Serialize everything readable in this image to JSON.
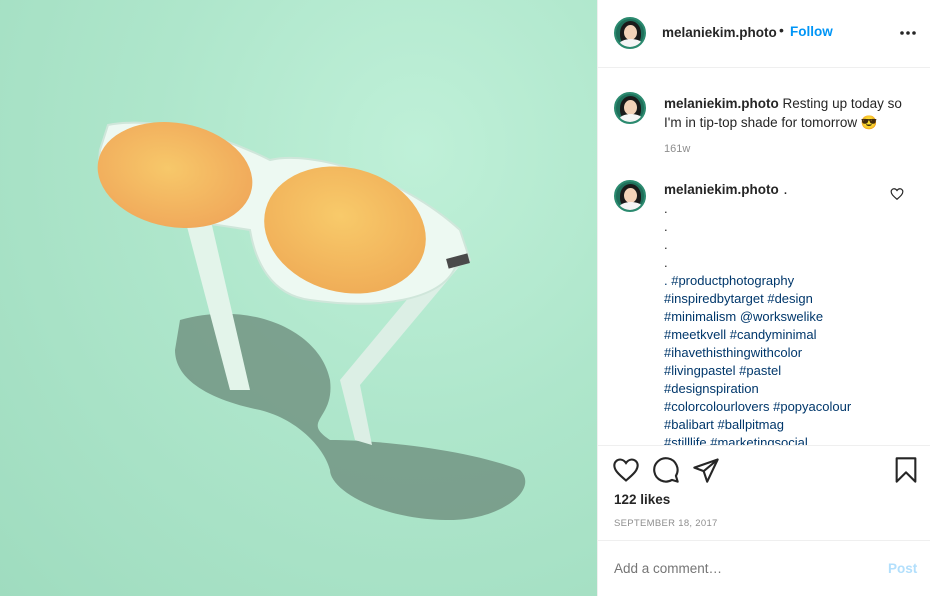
{
  "photo": {
    "alt_subject": "sunglasses-photo"
  },
  "header": {
    "username": "melaniekim.photo",
    "separator": "•",
    "follow_label": "Follow"
  },
  "caption": {
    "username": "melaniekim.photo",
    "text": "Resting up today so I'm in tip-top shade for tomorrow",
    "emoji": "😎",
    "time": "161w"
  },
  "comment": {
    "username": "melaniekim.photo",
    "first_line": ".",
    "dot_lines": [
      ".",
      ".",
      ".",
      "."
    ],
    "tag_lines": [
      ". #productphotography",
      "#inspiredbytarget #design",
      "#minimalism  @workswelike",
      "#meetkvell #candyminimal",
      "#ihavethisthingwithcolor",
      "#livingpastel #pastel",
      "#designspiration",
      "#colorcolourlovers #popyacolour",
      "#balibart #ballpitmag",
      "#stilllife #marketingsocial"
    ]
  },
  "stats": {
    "likes": "122 likes",
    "date": "SEPTEMBER 18, 2017"
  },
  "add_comment": {
    "placeholder": "Add a comment…",
    "post_label": "Post"
  },
  "colors": {
    "accent": "#0095f6",
    "post_disabled": "#b2dffc",
    "tag": "#00376b"
  }
}
